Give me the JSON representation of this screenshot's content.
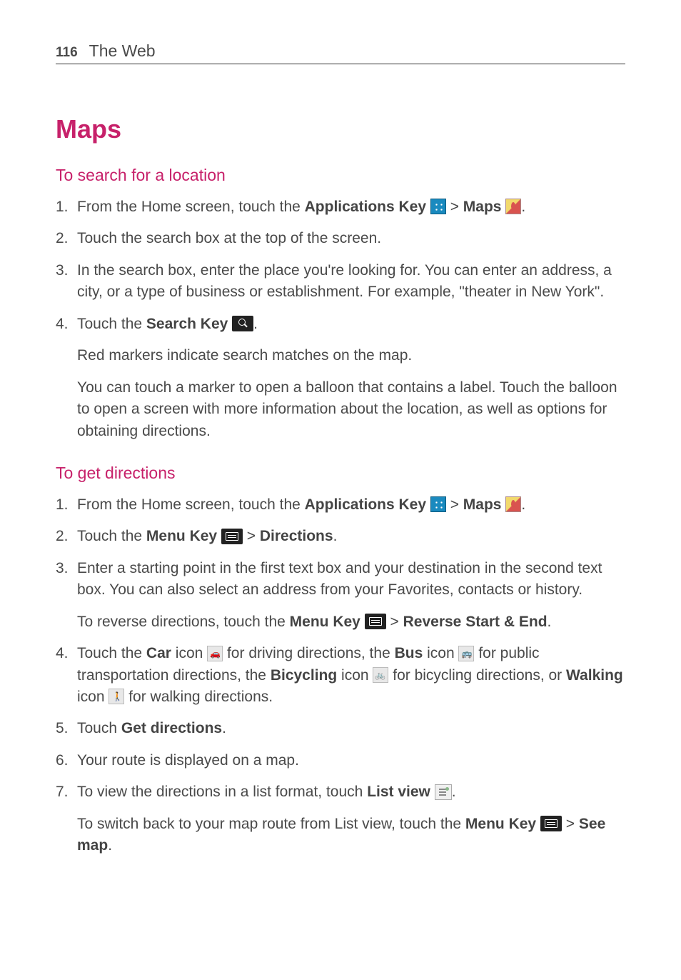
{
  "header": {
    "page_number": "116",
    "title": "The Web"
  },
  "title": "Maps",
  "section1": {
    "heading": "To search for a location",
    "step1_a": "From the Home screen, touch the ",
    "step1_b": "Applications Key",
    "step1_c": " > ",
    "step1_d": "Maps",
    "step1_e": ".",
    "step2": "Touch the search box at the top of the screen.",
    "step3": "In the search box, enter the place you're looking for. You can enter an address, a city, or a type of business or establishment. For example, \"theater in New York\".",
    "step4_a": "Touch the ",
    "step4_b": "Search Key",
    "step4_c": ".",
    "para1": "Red markers indicate search matches on the map.",
    "para2": "You can touch a marker to open a balloon that contains a label. Touch the balloon to open a screen with more information about the location, as well as options for obtaining directions."
  },
  "section2": {
    "heading": "To get directions",
    "step1_a": "From the Home screen, touch the ",
    "step1_b": "Applications Key",
    "step1_c": " > ",
    "step1_d": "Maps",
    "step1_e": ".",
    "step2_a": "Touch the ",
    "step2_b": "Menu Key",
    "step2_c": " > ",
    "step2_d": "Directions",
    "step2_e": ".",
    "step3": "Enter a starting point in the first text box and your destination in the second text box. You can also select an address from your Favorites, contacts or history.",
    "para1_a": "To reverse directions, touch the ",
    "para1_b": "Menu Key",
    "para1_c": " > ",
    "para1_d": "Reverse Start & End",
    "para1_e": ".",
    "step4_a": "Touch the ",
    "step4_b": "Car",
    "step4_c": " icon ",
    "step4_d": " for driving directions, the ",
    "step4_e": "Bus",
    "step4_f": " icon ",
    "step4_g": " for public transportation directions, the ",
    "step4_h": "Bicycling",
    "step4_i": " icon ",
    "step4_j": " for bicycling directions, or ",
    "step4_k": "Walking",
    "step4_l": " icon ",
    "step4_m": " for walking directions.",
    "step5_a": "Touch ",
    "step5_b": "Get directions",
    "step5_c": ".",
    "step6": "Your route is displayed on a map.",
    "step7_a": "To view the directions in a list format, touch ",
    "step7_b": "List view",
    "step7_c": ".",
    "para2_a": "To switch back to your map route from List view, touch the ",
    "para2_b": "Menu Key",
    "para2_c": " > ",
    "para2_d": "See map",
    "para2_e": "."
  }
}
